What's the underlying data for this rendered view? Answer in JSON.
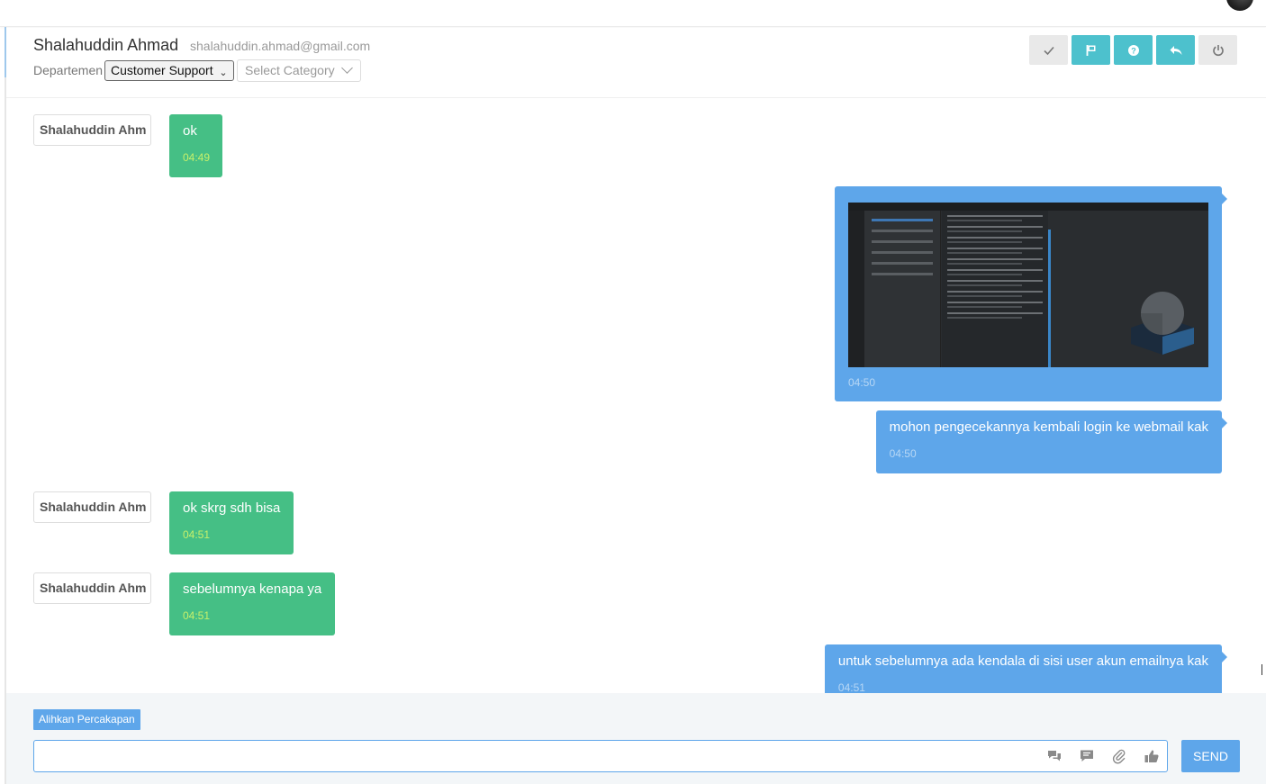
{
  "header": {
    "name": "Shalahuddin Ahmad",
    "email": "shalahuddin.ahmad@gmail.com",
    "department_label": "Departemen",
    "department_value": "Customer Support",
    "category_placeholder": "Select Category",
    "action_icons": [
      "check-icon",
      "flag-icon",
      "help-icon",
      "reply-icon",
      "power-icon"
    ]
  },
  "messages": [
    {
      "direction": "in",
      "sender": "Shalahuddin Ahm",
      "text": "ok",
      "time": "04:49"
    },
    {
      "direction": "out",
      "type": "image",
      "time": "04:50"
    },
    {
      "direction": "out",
      "text": "mohon pengecekannya kembali login ke webmail kak",
      "time": "04:50"
    },
    {
      "direction": "in",
      "sender": "Shalahuddin Ahm",
      "text": "ok skrg sdh bisa",
      "time": "04:51"
    },
    {
      "direction": "in",
      "sender": "Shalahuddin Ahm",
      "text": "sebelumnya kenapa ya",
      "time": "04:51"
    },
    {
      "direction": "out",
      "text": "untuk sebelumnya ada kendala di sisi user akun emailnya kak",
      "time": "04:51"
    }
  ],
  "composer": {
    "transfer_label": "Alihkan Percakapan",
    "input_value": "",
    "send_label": "SEND",
    "tool_icons": [
      "chat-bubbles-icon",
      "message-icon",
      "attachment-icon",
      "thumbs-up-icon"
    ]
  },
  "colors": {
    "incoming_bubble": "#45bf85",
    "outgoing_bubble": "#5ea6ea",
    "action_teal": "#4dc1cd",
    "incoming_time": "#c6f06a"
  }
}
